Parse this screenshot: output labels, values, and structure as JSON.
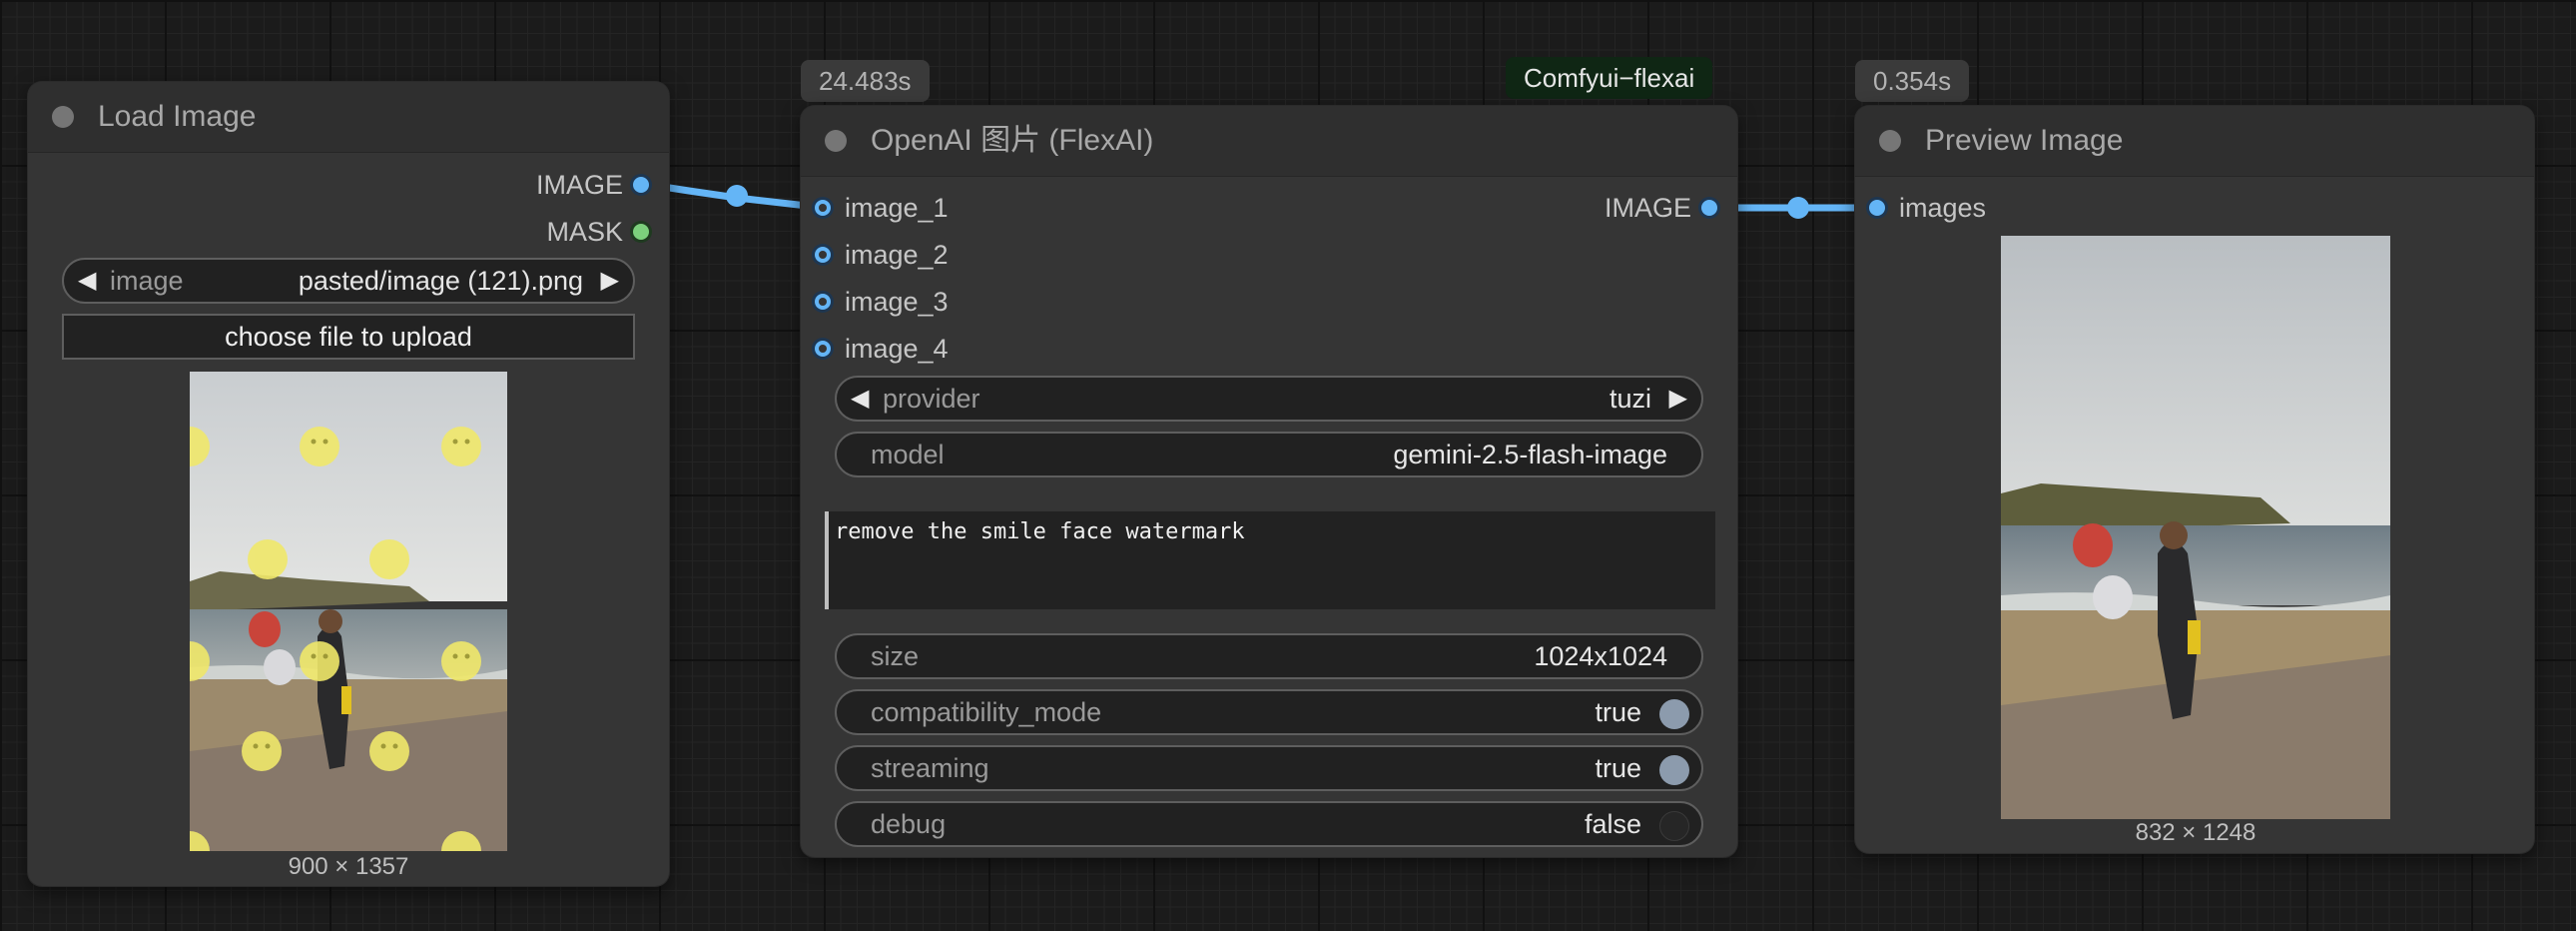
{
  "nodes": {
    "load_image": {
      "title": "Load Image",
      "outputs": [
        "IMAGE",
        "MASK"
      ],
      "image_widget": {
        "label": "image",
        "value": "pasted/image (121).png"
      },
      "upload_label": "choose file to upload",
      "image_size": "900 × 1357"
    },
    "openai": {
      "title": "OpenAI 图片 (FlexAI)",
      "time_badge": "24.483s",
      "group_badge": "Comfyui−flexai",
      "inputs": [
        "image_1",
        "image_2",
        "image_3",
        "image_4"
      ],
      "output": "IMAGE",
      "provider": {
        "label": "provider",
        "value": "tuzi"
      },
      "model": {
        "label": "model",
        "value": "gemini-2.5-flash-image"
      },
      "prompt": "remove the smile face watermark",
      "size": {
        "label": "size",
        "value": "1024x1024"
      },
      "compatibility_mode": {
        "label": "compatibility_mode",
        "value": "true",
        "state": "on"
      },
      "streaming": {
        "label": "streaming",
        "value": "true",
        "state": "on"
      },
      "debug": {
        "label": "debug",
        "value": "false",
        "state": "off"
      }
    },
    "preview_image": {
      "title": "Preview Image",
      "time_badge": "0.354s",
      "input": "images",
      "image_size": "832 × 1248"
    }
  },
  "colors": {
    "canvas": "#1b1b1b",
    "node_body": "#353535",
    "link": "#64b5f6",
    "image_slot": "#64b5f6",
    "mask_slot": "#7ccf7c",
    "group_badge": "#0f2614"
  }
}
